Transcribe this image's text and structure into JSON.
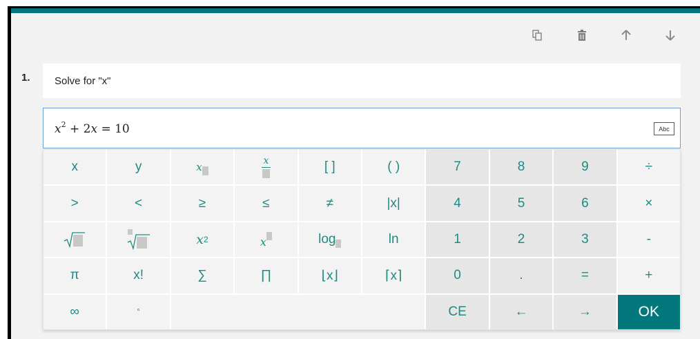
{
  "question": {
    "number": "1.",
    "title": "Solve for \"x\""
  },
  "answer": {
    "expression": {
      "base": "x",
      "exponent": "2",
      "rest_op": " + 2",
      "rest_var": "x",
      "equals": " = 10"
    },
    "abc_label": "Abc"
  },
  "toolbar": {
    "icons": [
      "copy-icon",
      "trash-icon",
      "arrow-up-icon",
      "arrow-down-icon"
    ]
  },
  "keypad": {
    "row1": [
      "x",
      "y",
      "",
      "",
      "[ ]",
      "( )",
      "7",
      "8",
      "9",
      "÷"
    ],
    "row2": [
      ">",
      "<",
      "≥",
      "≤",
      "≠",
      "|x|",
      "4",
      "5",
      "6",
      "×"
    ],
    "row3": [
      "",
      "",
      "",
      "",
      "log",
      "ln",
      "1",
      "2",
      "3",
      "-"
    ],
    "row4": [
      "π",
      "x!",
      "∑",
      "∏",
      "⌊x⌋",
      "⌈x⌉",
      "0",
      ".",
      "=",
      "+"
    ],
    "row5": [
      "∞",
      "°",
      "CE",
      "←",
      "→",
      "OK"
    ],
    "power_x": "x",
    "power_exp": "2",
    "sub_x": "x",
    "frac_x": "x"
  },
  "colors": {
    "accent": "#03787c",
    "key_text": "#1e8a82",
    "focus_border": "#6b9fd0"
  }
}
